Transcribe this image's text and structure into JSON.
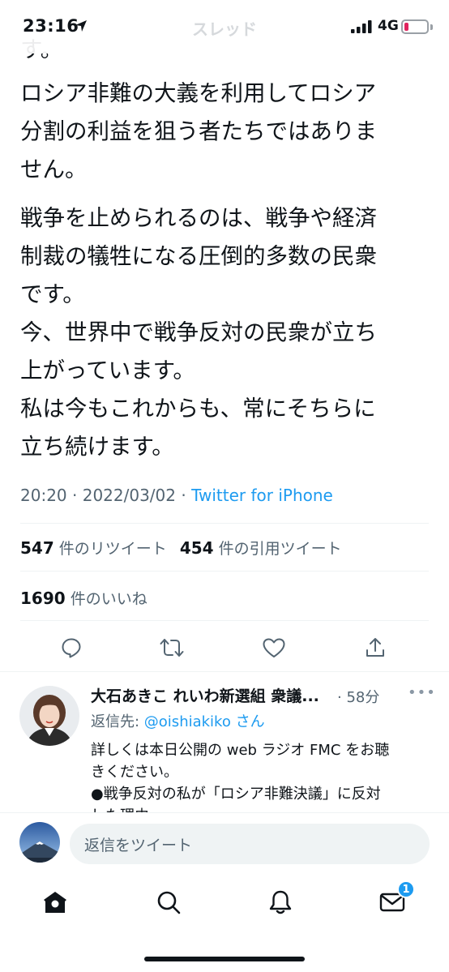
{
  "status_bar": {
    "time": "23:16",
    "header_ghost_title": "スレッド",
    "network": "4G"
  },
  "tweet": {
    "cut_off_line": "す。",
    "paragraph1": [
      "ロシア非難の大義を利用してロシア",
      "分割の利益を狙う者たちではありま",
      "せん。"
    ],
    "paragraph2": [
      "戦争を止められるのは、戦争や経済",
      "制裁の犠牲になる圧倒的多数の民衆",
      "です。",
      "今、世界中で戦争反対の民衆が立ち",
      "上がっています。",
      "私は今もこれからも、常にそちらに",
      "立ち続けます。"
    ],
    "time": "20:20",
    "separator": " · ",
    "date": "2022/03/02",
    "source": "Twitter for iPhone",
    "retweets": {
      "count": "547",
      "label": "件のリツイート"
    },
    "quotes": {
      "count": "454",
      "label": "件の引用ツイート"
    },
    "likes": {
      "count": "1690",
      "label": "件のいいね"
    }
  },
  "reply": {
    "name": "大石あきこ れいわ新選組 衆議...",
    "time": "· 58分",
    "more": "•••",
    "reply_to_prefix": "返信先: ",
    "reply_to_handle": "@oishiakiko",
    "reply_to_suffix": " さん",
    "text_lines": [
      "詳しくは本日公開の web ラジオ FMC をお聴",
      "きください。",
      "●戦争反対の私が「ロシア非難決議」に反対",
      "した理由"
    ]
  },
  "composer": {
    "placeholder": "返信をツイート"
  },
  "tabbar": {
    "items": [
      "home-icon",
      "search-icon",
      "bell-icon",
      "mail-icon"
    ],
    "messages_badge": "1"
  },
  "colors": {
    "accent": "#1d9bf0",
    "secondary_text": "#536471",
    "battery_low": "#e0245e"
  }
}
